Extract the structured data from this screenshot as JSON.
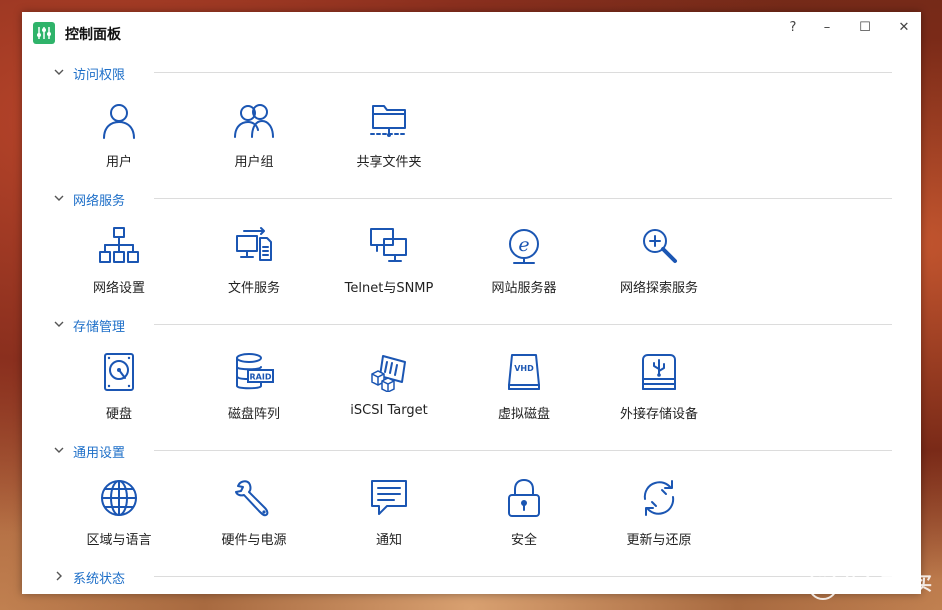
{
  "window": {
    "title": "控制面板",
    "help_label": "?",
    "minimize_label": "–",
    "maximize_label": "☐",
    "close_label": "✕"
  },
  "sections": [
    {
      "title": "访问权限",
      "expanded": true,
      "items": [
        {
          "label": "用户",
          "icon": "user-icon"
        },
        {
          "label": "用户组",
          "icon": "user-group-icon"
        },
        {
          "label": "共享文件夹",
          "icon": "shared-folder-icon"
        }
      ]
    },
    {
      "title": "网络服务",
      "expanded": true,
      "items": [
        {
          "label": "网络设置",
          "icon": "network-topology-icon"
        },
        {
          "label": "文件服务",
          "icon": "file-service-icon"
        },
        {
          "label": "Telnet与SNMP",
          "icon": "monitors-icon"
        },
        {
          "label": "网站服务器",
          "icon": "web-server-icon"
        },
        {
          "label": "网络探索服务",
          "icon": "magnifier-icon"
        }
      ]
    },
    {
      "title": "存储管理",
      "expanded": true,
      "items": [
        {
          "label": "硬盘",
          "icon": "hard-disk-icon"
        },
        {
          "label": "磁盘阵列",
          "icon": "raid-icon"
        },
        {
          "label": "iSCSI Target",
          "icon": "iscsi-icon"
        },
        {
          "label": "虚拟磁盘",
          "icon": "vhd-icon"
        },
        {
          "label": "外接存储设备",
          "icon": "usb-storage-icon"
        }
      ]
    },
    {
      "title": "通用设置",
      "expanded": true,
      "items": [
        {
          "label": "区域与语言",
          "icon": "globe-icon"
        },
        {
          "label": "硬件与电源",
          "icon": "wrench-icon"
        },
        {
          "label": "通知",
          "icon": "message-icon"
        },
        {
          "label": "安全",
          "icon": "lock-icon"
        },
        {
          "label": "更新与还原",
          "icon": "refresh-icon"
        }
      ]
    },
    {
      "title": "系统状态",
      "expanded": false,
      "items": []
    }
  ],
  "raid_text": "RAID",
  "vhd_text": "VHD",
  "watermark": {
    "mark": "值",
    "text": "什么值得买"
  },
  "colors": {
    "accent": "#1e6fc8",
    "icon": "#1b56b3",
    "app_icon": "#2fb36a"
  }
}
